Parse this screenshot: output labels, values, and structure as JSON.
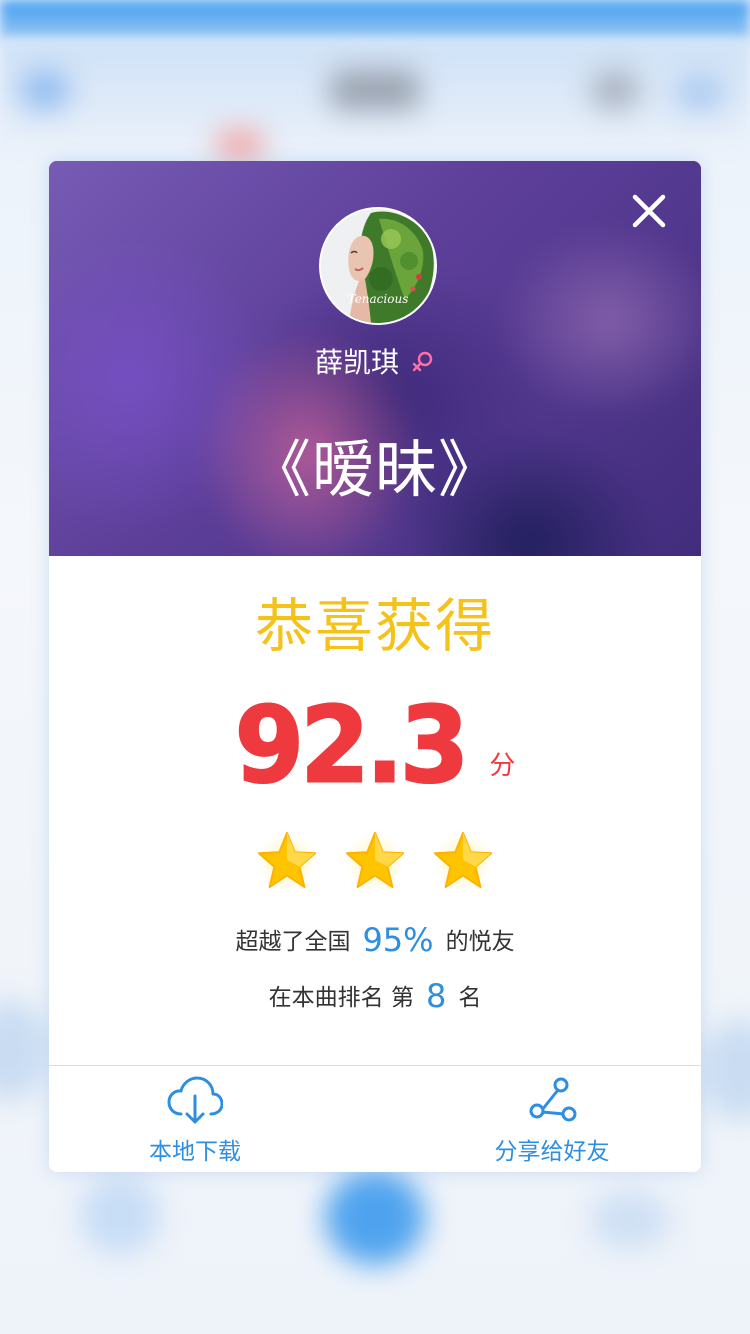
{
  "modal": {
    "artist_name": "薛凯琪",
    "song_title": "《暧昧》",
    "avatar_text": "Tenacious",
    "congrats_text": "恭喜获得",
    "score": "92.3",
    "score_unit": "分",
    "star_rating": 3,
    "stat1": {
      "prefix": "超越了全国",
      "value": "95%",
      "suffix": "的悦友"
    },
    "stat2": {
      "prefix": "在本曲排名  第",
      "value": "8",
      "suffix": "名"
    },
    "actions": {
      "download_label": "本地下载",
      "share_label": "分享给好友"
    }
  },
  "icons": {
    "close": "close-icon",
    "gender": "female-symbol-icon",
    "star": "star-icon",
    "download": "cloud-download-icon",
    "share": "share-icon"
  },
  "colors": {
    "congrats": "#f5c21a",
    "score": "#ee3a3e",
    "highlight": "#2e8ee0",
    "action": "#2e8ee0",
    "gender": "#ff6fa5",
    "star": "#ffc400"
  }
}
